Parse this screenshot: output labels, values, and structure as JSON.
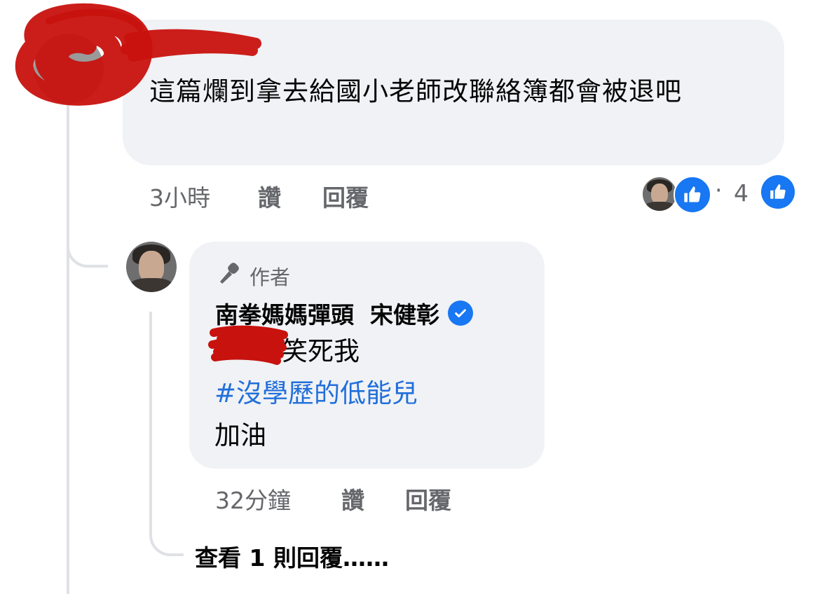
{
  "comment": {
    "text": "這篇爛到拿去給國小老師改聯絡簿都會被退吧",
    "time": "3小時",
    "like_label": "讚",
    "reply_label": "回覆",
    "reaction_count": "4"
  },
  "reply": {
    "badge": "作者",
    "author_name": "南拳媽媽彈頭  宋健彰",
    "line1": "笑死我",
    "hashtag": "#沒學歷的低能兒",
    "line3": "加油",
    "time": "32分鐘",
    "like_label": "讚",
    "reply_label": "回覆"
  },
  "view_replies": "查看 1 則回覆……",
  "colors": {
    "bubble": "#f0f2f5",
    "like_blue": "#1877f2",
    "hashtag": "#216fdb",
    "meta": "#65676b",
    "redaction": "#c8120e"
  }
}
